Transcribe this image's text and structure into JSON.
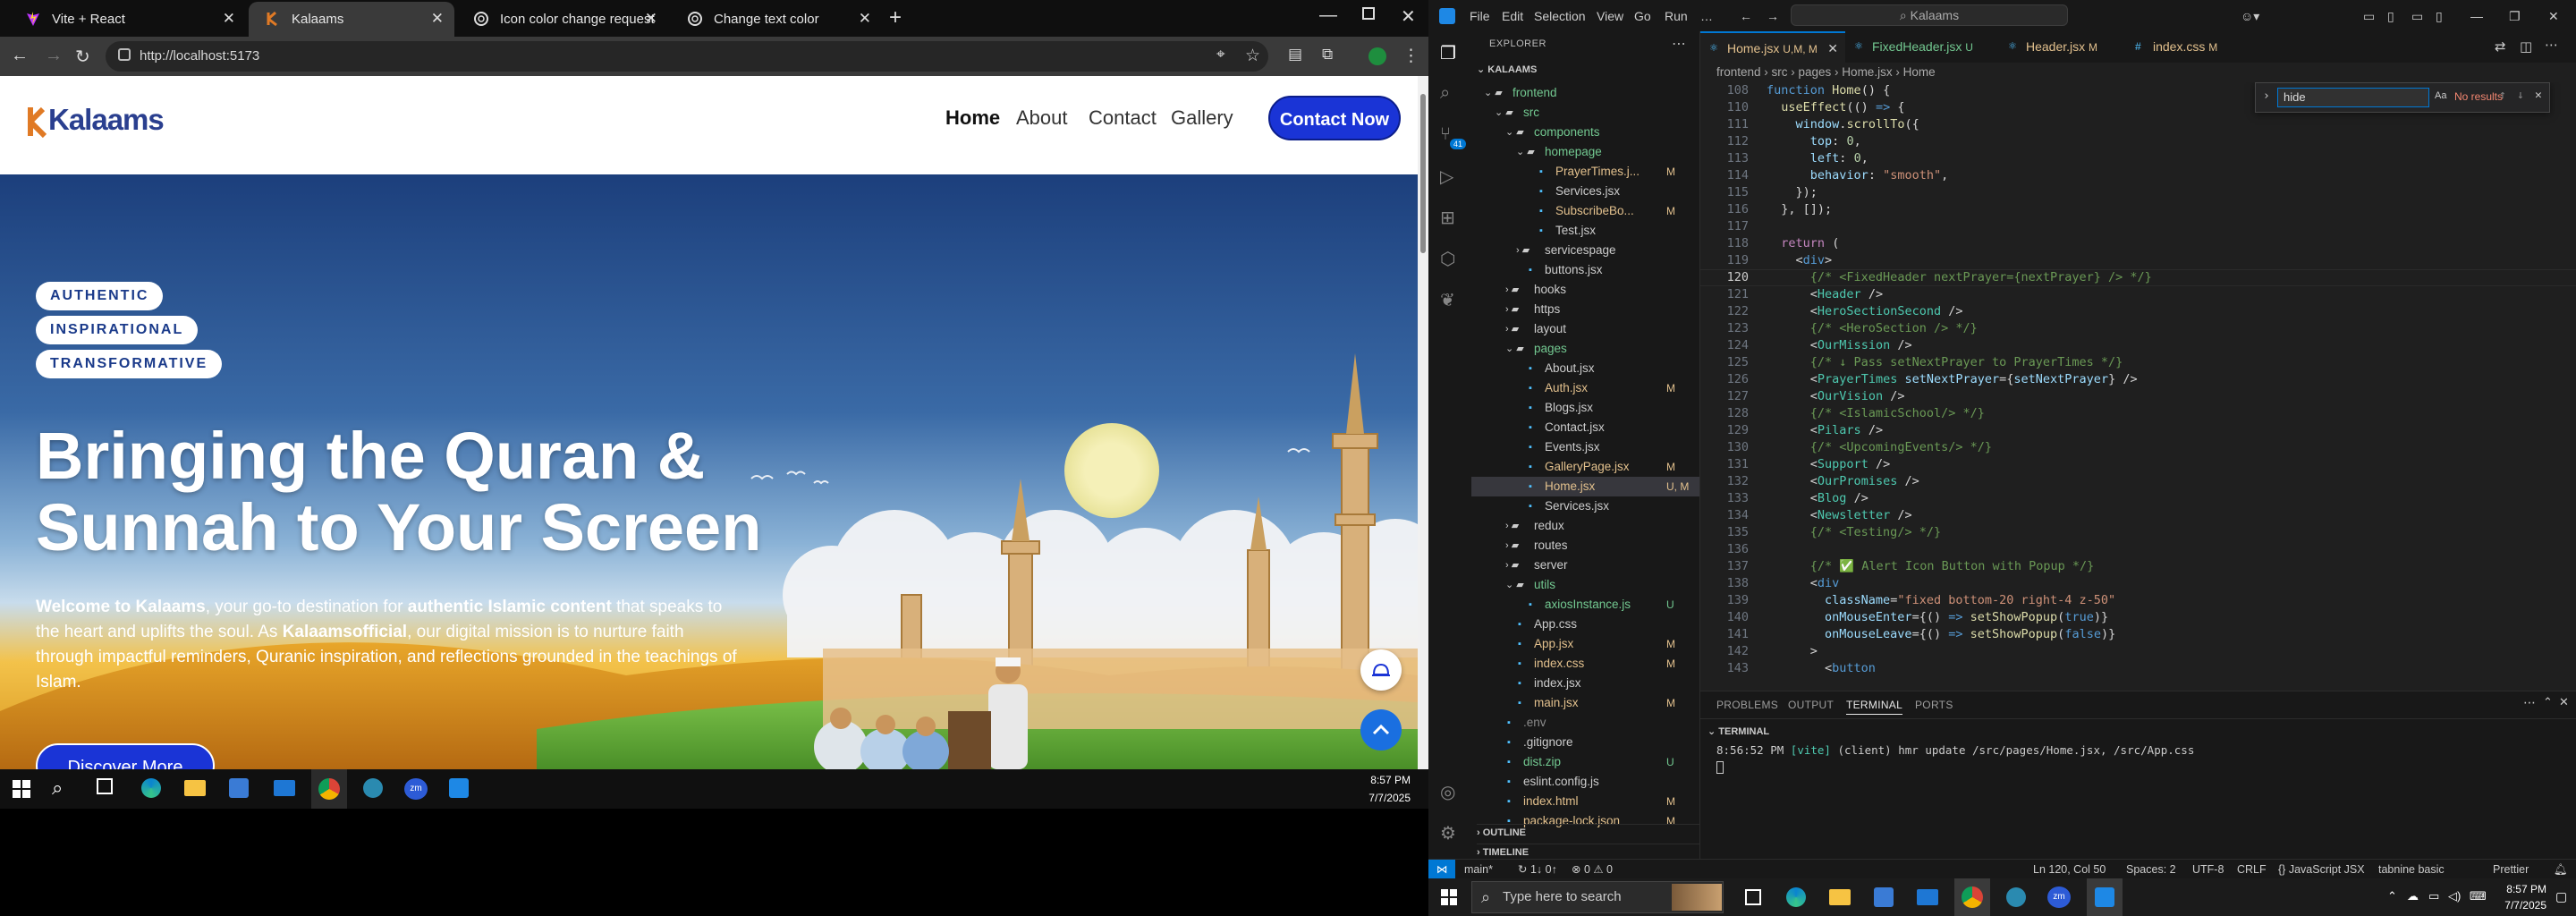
{
  "browser": {
    "tabs": [
      {
        "title": "Vite + React",
        "active": false
      },
      {
        "title": "Kalaams",
        "active": true
      },
      {
        "title": "Icon color change request",
        "active": false
      },
      {
        "title": "Change text color",
        "active": false
      }
    ],
    "url": "http://localhost:5173",
    "new_tab_icon": "plus-icon"
  },
  "site": {
    "logo_text": "Kalaams",
    "nav": [
      "Home",
      "About",
      "Contact",
      "Gallery"
    ],
    "cta": "Contact Now",
    "pills": [
      "AUTHENTIC",
      "INSPIRATIONAL",
      "TRANSFORMATIVE"
    ],
    "headline_1": "Bringing the Quran &",
    "headline_2": "Sunnah to Your Screen",
    "lead": {
      "p1": "Welcome to Kalaams",
      "p2": ", your go-to destination for ",
      "p3": "authentic Islamic content",
      "p4": " that speaks to the heart and uplifts the soul. As ",
      "p5": "Kalaamsofficial",
      "p6": ", our digital mission is to nurture faith through impactful reminders, Quranic inspiration, and reflections grounded in the teachings of Islam."
    },
    "discover": "Discover More"
  },
  "taskbar_left": {
    "time": "8:57 PM",
    "date": "7/7/2025"
  },
  "vscode": {
    "menu": [
      "File",
      "Edit",
      "Selection",
      "View",
      "Go",
      "Run",
      "…"
    ],
    "search": "Kalaams",
    "explorer_title": "EXPLORER",
    "root": "KALAAMS",
    "tree": [
      {
        "label": "frontend",
        "depth": 0,
        "type": "folder-open",
        "badge": "",
        "color": "#73c991"
      },
      {
        "label": "src",
        "depth": 1,
        "type": "folder-open",
        "badge": "",
        "color": "#73c991"
      },
      {
        "label": "components",
        "depth": 2,
        "type": "folder-open",
        "badge": "",
        "color": "#73c991"
      },
      {
        "label": "homepage",
        "depth": 3,
        "type": "folder-open",
        "badge": "",
        "color": "#73c991"
      },
      {
        "label": "PrayerTimes.j...",
        "depth": 4,
        "type": "file",
        "badge": "M",
        "color": "#e2c08d"
      },
      {
        "label": "Services.jsx",
        "depth": 4,
        "type": "file",
        "badge": "",
        "color": "#cccccc"
      },
      {
        "label": "SubscribeBo...",
        "depth": 4,
        "type": "file",
        "badge": "M",
        "color": "#e2c08d"
      },
      {
        "label": "Test.jsx",
        "depth": 4,
        "type": "file",
        "badge": "",
        "color": "#cccccc"
      },
      {
        "label": "servicespage",
        "depth": 3,
        "type": "folder",
        "badge": "",
        "color": "#cccccc"
      },
      {
        "label": "buttons.jsx",
        "depth": 3,
        "type": "file",
        "badge": "",
        "color": "#cccccc"
      },
      {
        "label": "hooks",
        "depth": 2,
        "type": "folder",
        "badge": "",
        "color": "#cccccc"
      },
      {
        "label": "https",
        "depth": 2,
        "type": "folder",
        "badge": "",
        "color": "#cccccc"
      },
      {
        "label": "layout",
        "depth": 2,
        "type": "folder",
        "badge": "",
        "color": "#cccccc"
      },
      {
        "label": "pages",
        "depth": 2,
        "type": "folder-open",
        "badge": "",
        "color": "#73c991"
      },
      {
        "label": "About.jsx",
        "depth": 3,
        "type": "file",
        "badge": "",
        "color": "#cccccc"
      },
      {
        "label": "Auth.jsx",
        "depth": 3,
        "type": "file",
        "badge": "M",
        "color": "#e2c08d"
      },
      {
        "label": "Blogs.jsx",
        "depth": 3,
        "type": "file",
        "badge": "",
        "color": "#cccccc"
      },
      {
        "label": "Contact.jsx",
        "depth": 3,
        "type": "file",
        "badge": "",
        "color": "#cccccc"
      },
      {
        "label": "Events.jsx",
        "depth": 3,
        "type": "file",
        "badge": "",
        "color": "#cccccc"
      },
      {
        "label": "GalleryPage.jsx",
        "depth": 3,
        "type": "file",
        "badge": "M",
        "color": "#e2c08d"
      },
      {
        "label": "Home.jsx",
        "depth": 3,
        "type": "file",
        "badge": "U, M",
        "color": "#e2c08d"
      },
      {
        "label": "Services.jsx",
        "depth": 3,
        "type": "file",
        "badge": "",
        "color": "#cccccc"
      },
      {
        "label": "redux",
        "depth": 2,
        "type": "folder",
        "badge": "",
        "color": "#cccccc"
      },
      {
        "label": "routes",
        "depth": 2,
        "type": "folder",
        "badge": "",
        "color": "#cccccc"
      },
      {
        "label": "server",
        "depth": 2,
        "type": "folder",
        "badge": "",
        "color": "#cccccc"
      },
      {
        "label": "utils",
        "depth": 2,
        "type": "folder-open",
        "badge": "",
        "color": "#73c991"
      },
      {
        "label": "axiosInstance.js",
        "depth": 3,
        "type": "file",
        "badge": "U",
        "color": "#73c991"
      },
      {
        "label": "App.css",
        "depth": 2,
        "type": "file",
        "badge": "",
        "color": "#cccccc"
      },
      {
        "label": "App.jsx",
        "depth": 2,
        "type": "file",
        "badge": "M",
        "color": "#e2c08d"
      },
      {
        "label": "index.css",
        "depth": 2,
        "type": "file",
        "badge": "M",
        "color": "#e2c08d"
      },
      {
        "label": "index.jsx",
        "depth": 2,
        "type": "file",
        "badge": "",
        "color": "#cccccc"
      },
      {
        "label": "main.jsx",
        "depth": 2,
        "type": "file",
        "badge": "M",
        "color": "#e2c08d"
      },
      {
        "label": ".env",
        "depth": 1,
        "type": "file",
        "badge": "",
        "color": "#8b8b8b"
      },
      {
        "label": ".gitignore",
        "depth": 1,
        "type": "file",
        "badge": "",
        "color": "#cccccc"
      },
      {
        "label": "dist.zip",
        "depth": 1,
        "type": "file",
        "badge": "U",
        "color": "#73c991"
      },
      {
        "label": "eslint.config.js",
        "depth": 1,
        "type": "file",
        "badge": "",
        "color": "#cccccc"
      },
      {
        "label": "index.html",
        "depth": 1,
        "type": "file",
        "badge": "M",
        "color": "#e2c08d"
      },
      {
        "label": "package-lock.json",
        "depth": 1,
        "type": "file",
        "badge": "M",
        "color": "#e2c08d"
      }
    ],
    "outline": "OUTLINE",
    "timeline": "TIMELINE",
    "editor_tabs": [
      {
        "label": "Home.jsx",
        "badge": "U,M, M",
        "active": true
      },
      {
        "label": "FixedHeader.jsx",
        "badge": "U",
        "active": false
      },
      {
        "label": "Header.jsx",
        "badge": "M",
        "active": false
      },
      {
        "label": "index.css",
        "badge": "M",
        "active": false
      }
    ],
    "breadcrumb": "frontend › src › pages › Home.jsx › Home",
    "find": {
      "query": "hide",
      "result": "No results"
    },
    "code_lines": [
      {
        "n": "108",
        "html": "<span class='c-kw'>function</span> <span class='c-fn'>Home</span><span class='c-pn'>() {</span>"
      },
      {
        "n": "110",
        "html": "  <span class='c-fn'>useEffect</span><span class='c-pn'>(() </span><span class='c-kw'>=&gt;</span><span class='c-pn'> {</span>"
      },
      {
        "n": "111",
        "html": "    <span class='c-var'>window</span><span class='c-pn'>.</span><span class='c-fn'>scrollTo</span><span class='c-pn'>({</span>"
      },
      {
        "n": "112",
        "html": "      <span class='c-var'>top</span><span class='c-pn'>: </span><span class='c-num'>0</span><span class='c-pn'>,</span>"
      },
      {
        "n": "113",
        "html": "      <span class='c-var'>left</span><span class='c-pn'>: </span><span class='c-num'>0</span><span class='c-pn'>,</span>"
      },
      {
        "n": "114",
        "html": "      <span class='c-var'>behavior</span><span class='c-pn'>: </span><span class='c-str'>\"smooth\"</span><span class='c-pn'>,</span>"
      },
      {
        "n": "115",
        "html": "    <span class='c-pn'>});</span>"
      },
      {
        "n": "116",
        "html": "  <span class='c-pn'>}, []);</span>"
      },
      {
        "n": "117",
        "html": ""
      },
      {
        "n": "118",
        "html": "  <span class='c-ctl'>return</span> <span class='c-pn'>(</span>"
      },
      {
        "n": "119",
        "html": "    <span class='c-pn'>&lt;</span><span class='c-kw'>div</span><span class='c-pn'>&gt;</span>"
      },
      {
        "n": "120",
        "html": "      <span class='c-cm'>{/* &lt;FixedHeader nextPrayer={nextPrayer} /&gt; */}</span>"
      },
      {
        "n": "121",
        "html": "      <span class='c-pn'>&lt;</span><span class='c-tag'>Header</span><span class='c-pn'> /&gt;</span>"
      },
      {
        "n": "122",
        "html": "      <span class='c-pn'>&lt;</span><span class='c-tag'>HeroSectionSecond</span><span class='c-pn'> /&gt;</span>"
      },
      {
        "n": "123",
        "html": "      <span class='c-cm'>{/* &lt;HeroSection /&gt; */}</span>"
      },
      {
        "n": "124",
        "html": "      <span class='c-pn'>&lt;</span><span class='c-tag'>OurMission</span><span class='c-pn'> /&gt;</span>"
      },
      {
        "n": "125",
        "html": "      <span class='c-cm'>{/* ↓ Pass setNextPrayer to PrayerTimes */}</span>"
      },
      {
        "n": "126",
        "html": "      <span class='c-pn'>&lt;</span><span class='c-tag'>PrayerTimes</span> <span class='c-var'>setNextPrayer</span><span class='c-pn'>={</span><span class='c-var'>setNextPrayer</span><span class='c-pn'>} /&gt;</span>"
      },
      {
        "n": "127",
        "html": "      <span class='c-pn'>&lt;</span><span class='c-tag'>OurVision</span><span class='c-pn'> /&gt;</span>"
      },
      {
        "n": "128",
        "html": "      <span class='c-cm'>{/* &lt;IslamicSchool/&gt; */}</span>"
      },
      {
        "n": "129",
        "html": "      <span class='c-pn'>&lt;</span><span class='c-tag'>Pilars</span><span class='c-pn'> /&gt;</span>"
      },
      {
        "n": "130",
        "html": "      <span class='c-cm'>{/* &lt;UpcomingEvents/&gt; */}</span>"
      },
      {
        "n": "131",
        "html": "      <span class='c-pn'>&lt;</span><span class='c-tag'>Support</span><span class='c-pn'> /&gt;</span>"
      },
      {
        "n": "132",
        "html": "      <span class='c-pn'>&lt;</span><span class='c-tag'>OurPromises</span><span class='c-pn'> /&gt;</span>"
      },
      {
        "n": "133",
        "html": "      <span class='c-pn'>&lt;</span><span class='c-tag'>Blog</span><span class='c-pn'> /&gt;</span>"
      },
      {
        "n": "134",
        "html": "      <span class='c-pn'>&lt;</span><span class='c-tag'>Newsletter</span><span class='c-pn'> /&gt;</span>"
      },
      {
        "n": "135",
        "html": "      <span class='c-cm'>{/* &lt;Testing/&gt; */}</span>"
      },
      {
        "n": "136",
        "html": ""
      },
      {
        "n": "137",
        "html": "      <span class='c-cm'>{/* ✅ Alert Icon Button with Popup */}</span>"
      },
      {
        "n": "138",
        "html": "      <span class='c-pn'>&lt;</span><span class='c-kw'>div</span>"
      },
      {
        "n": "139",
        "html": "        <span class='c-var'>className</span><span class='c-pn'>=</span><span class='c-str'>\"fixed bottom-20 right-4 z-50\"</span>"
      },
      {
        "n": "140",
        "html": "        <span class='c-var'>onMouseEnter</span><span class='c-pn'>={() </span><span class='c-kw'>=&gt;</span> <span class='c-fn'>setShowPopup</span><span class='c-pn'>(</span><span class='c-kw'>true</span><span class='c-pn'>)}</span>"
      },
      {
        "n": "141",
        "html": "        <span class='c-var'>onMouseLeave</span><span class='c-pn'>={() </span><span class='c-kw'>=&gt;</span> <span class='c-fn'>setShowPopup</span><span class='c-pn'>(</span><span class='c-kw'>false</span><span class='c-pn'>)}</span>"
      },
      {
        "n": "142",
        "html": "      <span class='c-pn'>&gt;</span>"
      },
      {
        "n": "143",
        "html": "        <span class='c-pn'>&lt;</span><span class='c-kw'>button</span>"
      }
    ],
    "panel_tabs": [
      "PROBLEMS",
      "OUTPUT",
      "TERMINAL",
      "PORTS"
    ],
    "terminal_title": "TERMINAL",
    "terminal_time": "8:56:52 PM",
    "terminal_tag": "[vite]",
    "terminal_msg": "(client) hmr update /src/pages/Home.jsx, /src/App.css",
    "status_left": [
      "main*",
      "↻ 1↓ 0↑",
      "⊗ 0 ⚠ 0"
    ],
    "status_right": [
      "Ln 120, Col 50",
      "Spaces: 2",
      "UTF-8",
      "CRLF",
      "{} JavaScript JSX",
      "tabnine basic",
      "Prettier"
    ],
    "win_search": "Type here to search",
    "win_time": "8:57 PM",
    "win_date": "7/7/2025"
  }
}
